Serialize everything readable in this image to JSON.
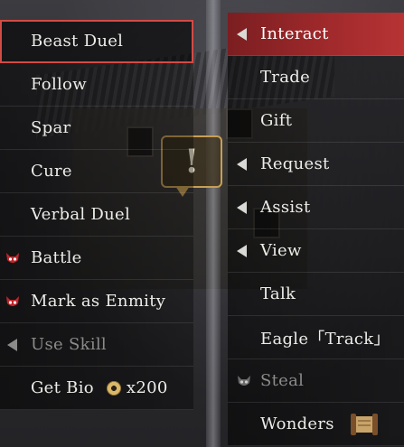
{
  "left_menu": {
    "items": [
      {
        "label": "Beast Duel",
        "state": "selected",
        "marker": "none"
      },
      {
        "label": "Follow",
        "state": "normal",
        "marker": "none"
      },
      {
        "label": "Spar",
        "state": "normal",
        "marker": "none"
      },
      {
        "label": "Cure",
        "state": "normal",
        "marker": "none"
      },
      {
        "label": "Verbal Duel",
        "state": "normal",
        "marker": "none"
      },
      {
        "label": "Battle",
        "state": "normal",
        "marker": "demon-mask-icon"
      },
      {
        "label": "Mark as Enmity",
        "state": "normal",
        "marker": "demon-mask-icon"
      },
      {
        "label": "Use Skill",
        "state": "disabled",
        "marker": "submenu-arrow-icon"
      },
      {
        "label": "Get Bio",
        "state": "normal",
        "marker": "none",
        "cost_amount": "x200",
        "cost_icon": "coin-icon"
      }
    ]
  },
  "right_menu": {
    "items": [
      {
        "label": "Interact",
        "state": "active",
        "marker": "submenu-arrow-icon"
      },
      {
        "label": "Trade",
        "state": "normal",
        "marker": "none"
      },
      {
        "label": "Gift",
        "state": "normal",
        "marker": "none"
      },
      {
        "label": "Request",
        "state": "normal",
        "marker": "submenu-arrow-icon"
      },
      {
        "label": "Assist",
        "state": "normal",
        "marker": "submenu-arrow-icon"
      },
      {
        "label": "View",
        "state": "normal",
        "marker": "submenu-arrow-icon"
      },
      {
        "label": "Talk",
        "state": "normal",
        "marker": "none"
      },
      {
        "label": "Eagle「Track」",
        "state": "normal",
        "marker": "none"
      },
      {
        "label": "Steal",
        "state": "disabled",
        "marker": "demon-mask-icon"
      },
      {
        "label": "Wonders",
        "state": "normal",
        "marker": "none",
        "trailing_icon": "scroll-icon"
      }
    ]
  },
  "scene": {
    "alert_symbol": "!"
  },
  "colors": {
    "active_bg": "#a22a2c",
    "selected_outline": "#d24b45",
    "text": "#ecece8",
    "disabled_text": "#8b8b8a",
    "mask_red": "#c0262a"
  }
}
